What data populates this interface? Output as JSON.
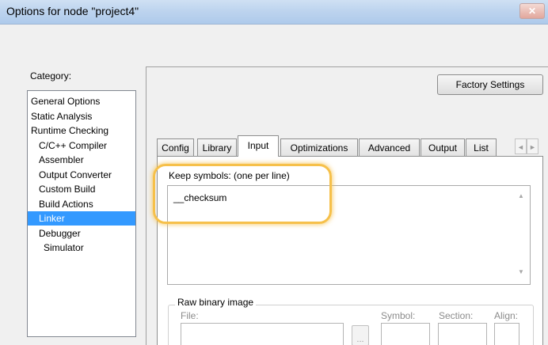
{
  "window": {
    "title": "Options for node \"project4\"",
    "close_icon": "✕"
  },
  "category": {
    "label": "Category:",
    "items": [
      {
        "label": "General Options",
        "indent": 0,
        "selected": false
      },
      {
        "label": "Static Analysis",
        "indent": 0,
        "selected": false
      },
      {
        "label": "Runtime Checking",
        "indent": 0,
        "selected": false
      },
      {
        "label": "C/C++ Compiler",
        "indent": 1,
        "selected": false
      },
      {
        "label": "Assembler",
        "indent": 1,
        "selected": false
      },
      {
        "label": "Output Converter",
        "indent": 1,
        "selected": false
      },
      {
        "label": "Custom Build",
        "indent": 1,
        "selected": false
      },
      {
        "label": "Build Actions",
        "indent": 1,
        "selected": false
      },
      {
        "label": "Linker",
        "indent": 1,
        "selected": true
      },
      {
        "label": "Debugger",
        "indent": 1,
        "selected": false
      },
      {
        "label": "Simulator",
        "indent": 2,
        "selected": false
      }
    ]
  },
  "factory_settings": "Factory Settings",
  "tabs": [
    "Config",
    "Library",
    "Input",
    "Optimizations",
    "Advanced",
    "Output",
    "List"
  ],
  "active_tab": "Input",
  "tab_scroll": {
    "left": "◄",
    "right": "►"
  },
  "input_page": {
    "keep_label": "Keep symbols: (one per line)",
    "keep_value": "__checksum",
    "raw_binary": {
      "legend": "Raw binary image",
      "file_label": "File:",
      "symbol_label": "Symbol:",
      "section_label": "Section:",
      "align_label": "Align:",
      "browse_label": "..."
    }
  },
  "colors": {
    "selection": "#3399ff",
    "highlight": "#f6c04a"
  }
}
